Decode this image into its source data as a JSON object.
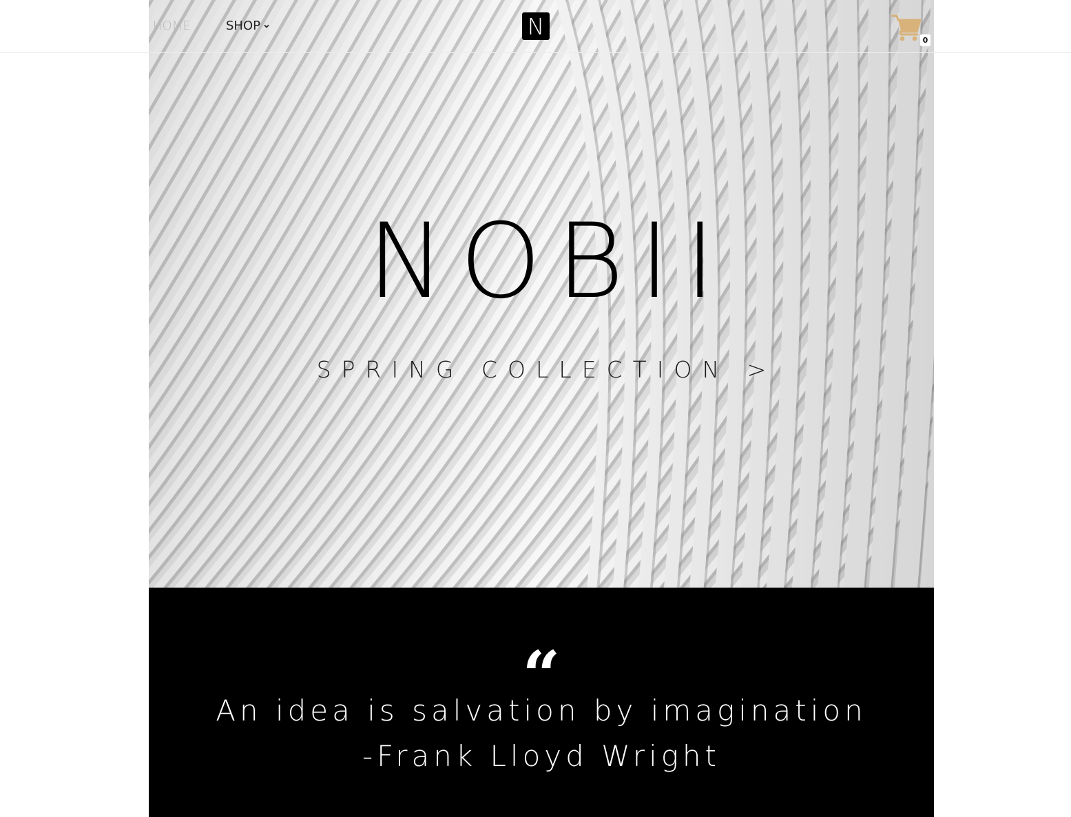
{
  "nav": {
    "home_label": "HOME",
    "shop_label": "SHOP"
  },
  "logo": {
    "letter": "N"
  },
  "cart": {
    "count": "0",
    "icon": "cart-icon",
    "color": "#D8B27A"
  },
  "hero": {
    "title": "NOBII",
    "subtitle": "SPRING COLLECTION >"
  },
  "quote": {
    "mark": "“",
    "line1": "An idea is salvation by imagination",
    "line2": "-Frank Lloyd Wright"
  },
  "colors": {
    "quote_bg": "#000000",
    "hero_bg": "#E9E9E9"
  }
}
